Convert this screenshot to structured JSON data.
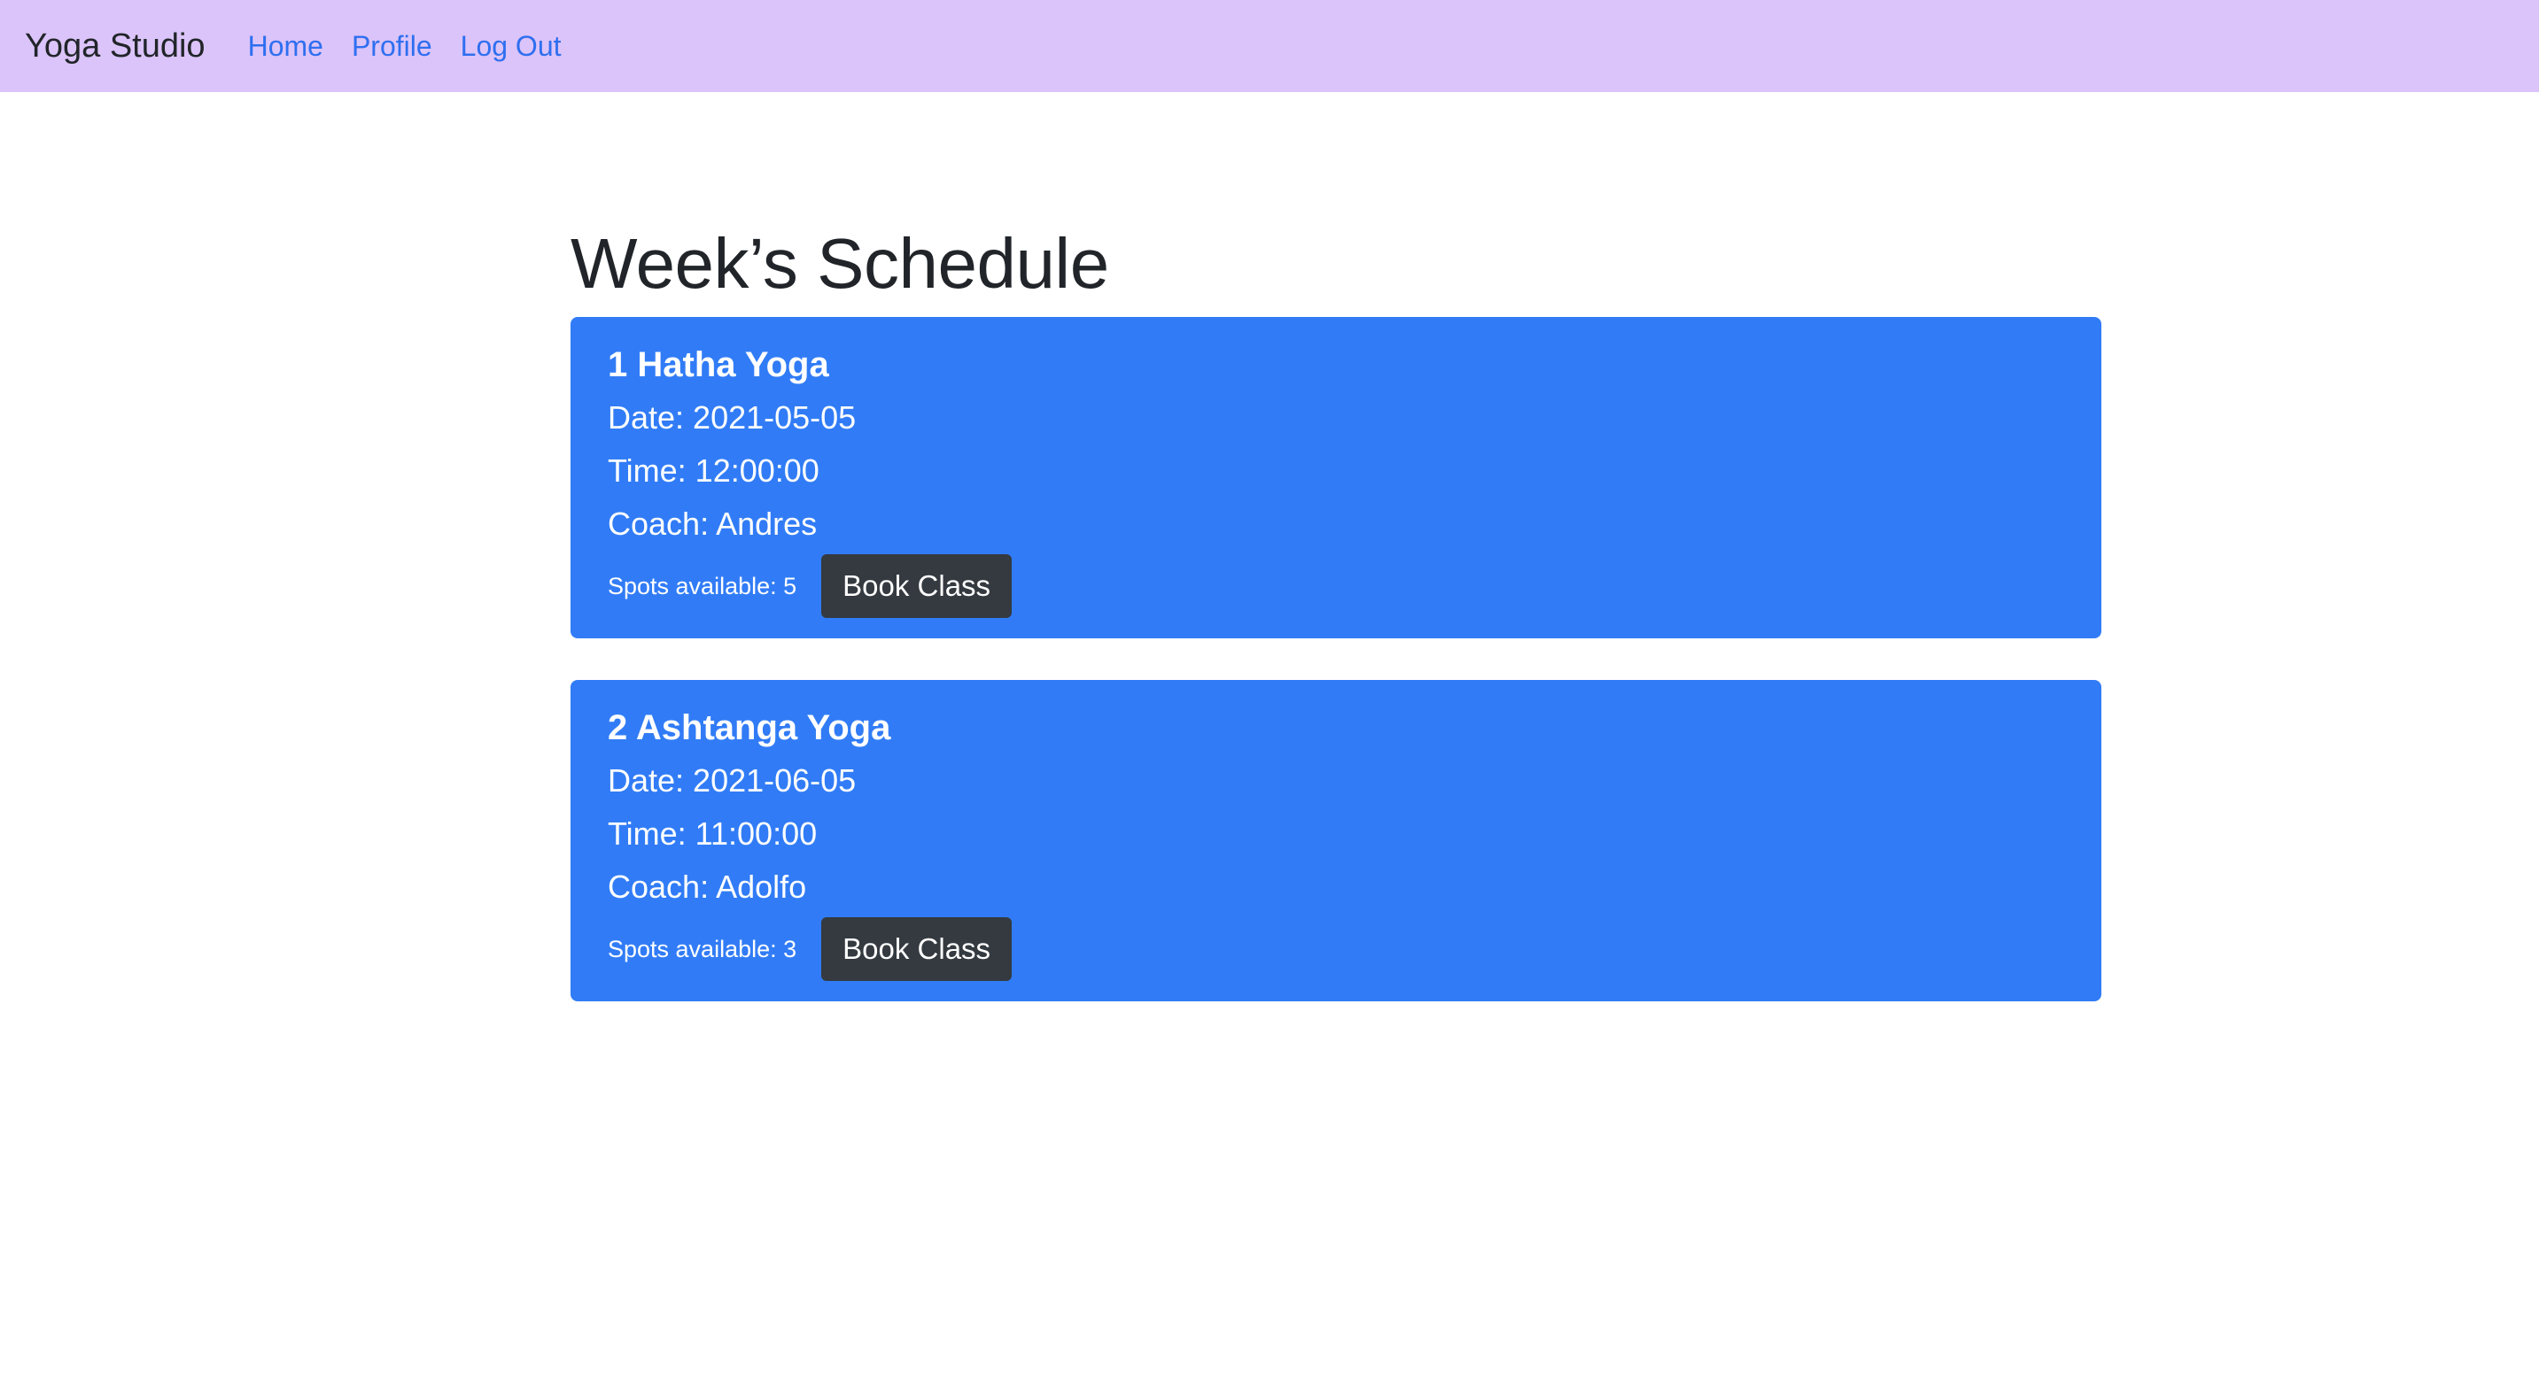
{
  "navbar": {
    "brand": "Yoga Studio",
    "links": [
      "Home",
      "Profile",
      "Log Out"
    ],
    "background": "#dbc4f9",
    "link_color": "#2f6ff0"
  },
  "main": {
    "title": "Week’s Schedule",
    "classes": [
      {
        "title": "1 Hatha Yoga",
        "date": "Date: 2021-05-05",
        "time": "Time: 12:00:00",
        "coach": "Coach: Andres",
        "spots": "Spots available: 5",
        "button": "Book Class"
      },
      {
        "title": "2 Ashtanga Yoga",
        "date": "Date: 2021-06-05",
        "time": "Time: 11:00:00",
        "coach": "Coach: Adolfo",
        "spots": "Spots available: 3",
        "button": "Book Class"
      }
    ]
  },
  "colors": {
    "card_background": "#317cf6",
    "button_background": "#343a40"
  }
}
